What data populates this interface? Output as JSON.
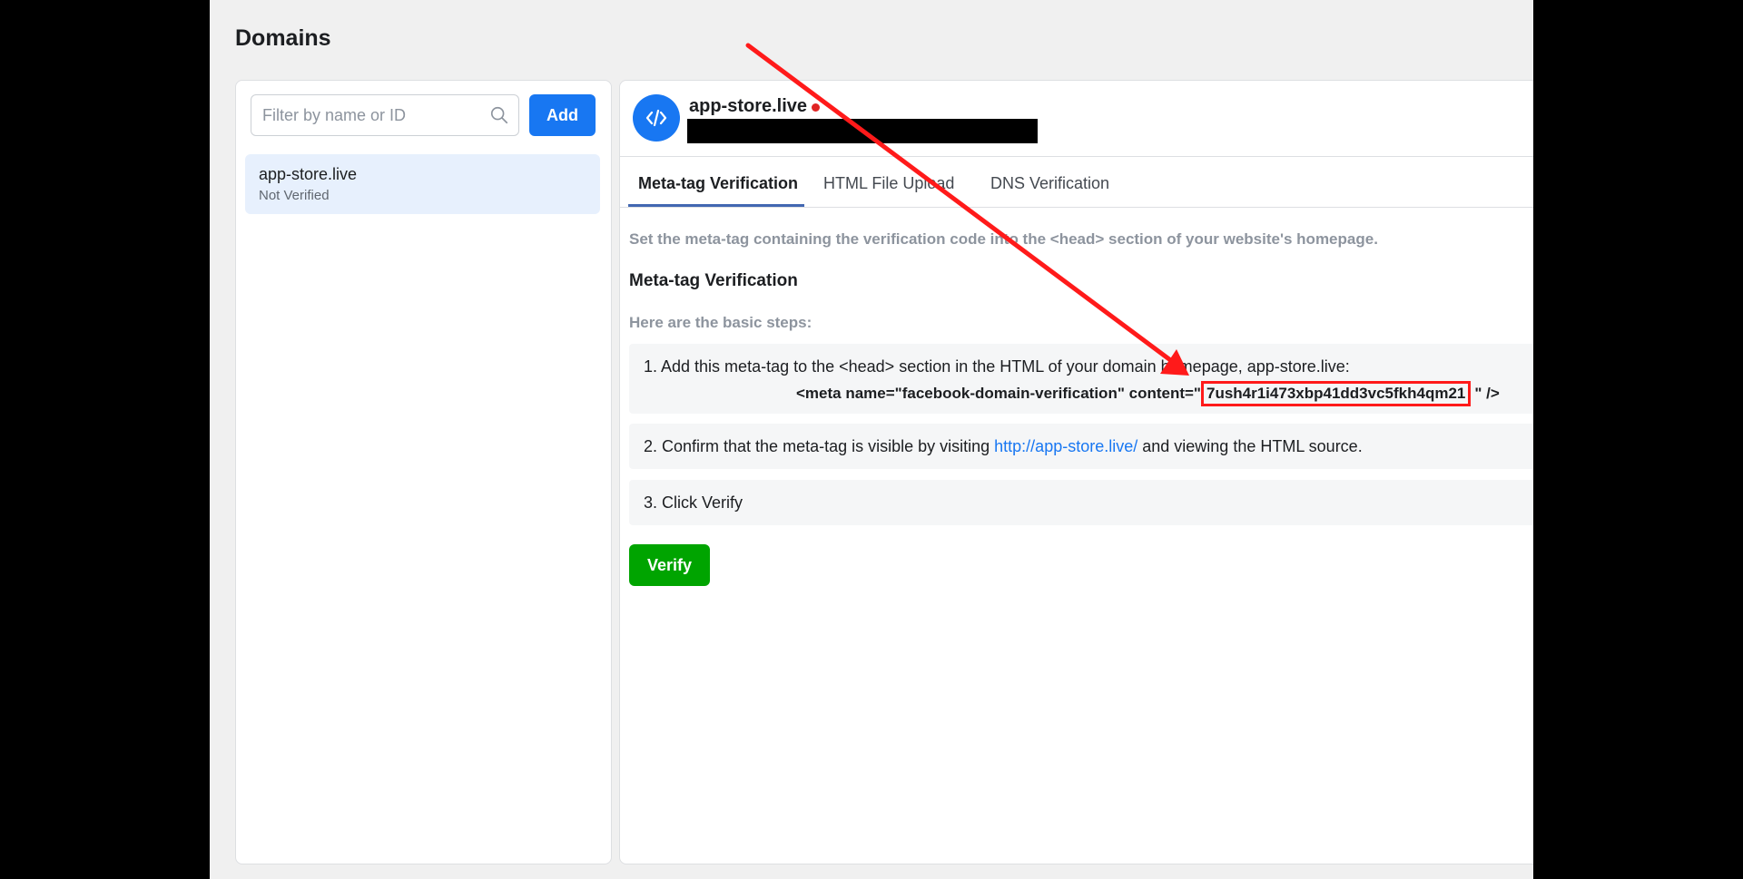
{
  "page": {
    "title": "Domains"
  },
  "left_panel": {
    "search": {
      "placeholder": "Filter by name or ID",
      "value": ""
    },
    "add_button": "Add",
    "domains": [
      {
        "name": "app-store.live",
        "status": "Not Verified"
      }
    ]
  },
  "right_panel": {
    "domain_name": "app-store.live",
    "tabs": [
      {
        "label": "Meta-tag Verification",
        "active": true
      },
      {
        "label": "HTML File Upload",
        "active": false
      },
      {
        "label": "DNS Verification",
        "active": false
      }
    ],
    "instruction": "Set the meta-tag containing the verification code into the <head> section of your website's homepage.",
    "section_heading": "Meta-tag Verification",
    "steps_intro": "Here are the basic steps:",
    "step1": {
      "text": "1. Add this meta-tag to the <head> section in the HTML of your domain homepage, app-store.live:",
      "meta_prefix": "<meta name=\"facebook-domain-verification\" content=\"",
      "meta_code": "7ush4r1i473xbp41dd3vc5fkh4qm21",
      "meta_suffix": "\" />"
    },
    "step2": {
      "prefix": "2. Confirm that the meta-tag is visible by visiting ",
      "link": "http://app-store.live/",
      "suffix": " and viewing the HTML source."
    },
    "step3": {
      "text": "3. Click Verify"
    },
    "verify_button": "Verify"
  },
  "colors": {
    "primary_blue": "#1877f2",
    "verify_green": "#00a400",
    "annotation_red": "#ff1a1a",
    "tab_underline": "#4267b2"
  },
  "icons": {
    "search": "search-icon",
    "avatar": "code-icon",
    "annotation": "arrow-annotation-icon"
  }
}
